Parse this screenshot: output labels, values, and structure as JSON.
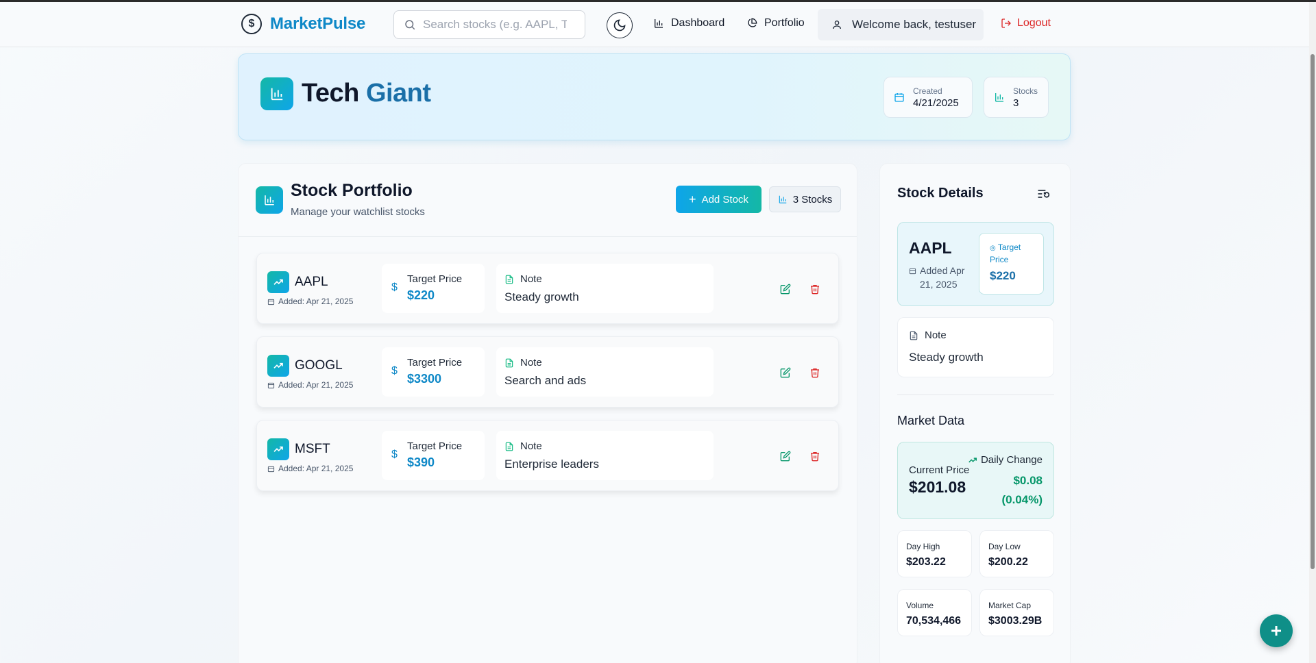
{
  "navbar": {
    "brand": "MarketPulse",
    "search_placeholder": "Search stocks (e.g. AAPL, TSLA)",
    "dashboard_label": "Dashboard",
    "portfolio_label": "Portfolio",
    "welcome_text": "Welcome back, testuser",
    "logout_label": "Logout"
  },
  "hero": {
    "title_part1": "Tech",
    "title_part2": "Giant",
    "created_label": "Created",
    "created_value": "4/21/2025",
    "stocks_label": "Stocks",
    "stocks_value": "3"
  },
  "portfolio": {
    "title": "Stock Portfolio",
    "subtitle": "Manage your watchlist stocks",
    "add_button": "Add Stock",
    "count_badge": "3 Stocks",
    "target_label": "Target Price",
    "note_label": "Note",
    "stocks": [
      {
        "symbol": "AAPL",
        "added": "Added: Apr 21, 2025",
        "target": "$220",
        "note": "Steady growth"
      },
      {
        "symbol": "GOOGL",
        "added": "Added: Apr 21, 2025",
        "target": "$3300",
        "note": "Search and ads"
      },
      {
        "symbol": "MSFT",
        "added": "Added: Apr 21, 2025",
        "target": "$390",
        "note": "Enterprise leaders"
      }
    ]
  },
  "details": {
    "title": "Stock Details",
    "symbol": "AAPL",
    "added": "Added Apr 21, 2025",
    "target_label": "Target Price",
    "target_value": "$220",
    "note_label": "Note",
    "note_value": "Steady growth",
    "market_title": "Market Data",
    "current_price_label": "Current Price",
    "current_price": "$201.08",
    "daily_change_label": "Daily Change",
    "daily_change": "$0.08 (0.04%)",
    "day_high_label": "Day High",
    "day_high": "$203.22",
    "day_low_label": "Day Low",
    "day_low": "$200.22",
    "volume_label": "Volume",
    "volume": "70,534,466",
    "market_cap_label": "Market Cap",
    "market_cap": "$3003.29B"
  },
  "colors": {
    "brand": "#0e88c7",
    "accent_gradient_start": "#0ea5e9",
    "accent_gradient_end": "#14b8a6",
    "positive": "#059669",
    "danger": "#dc2626"
  },
  "icons": {
    "brand": "dollar-circle-icon",
    "theme": "moon-icon",
    "dashboard": "bar-chart-icon",
    "portfolio": "pie-chart-icon",
    "user": "user-icon",
    "logout": "logout-icon",
    "row": "trending-up-icon",
    "edit": "edit-icon",
    "delete": "trash-icon",
    "fab": "plus-icon"
  }
}
